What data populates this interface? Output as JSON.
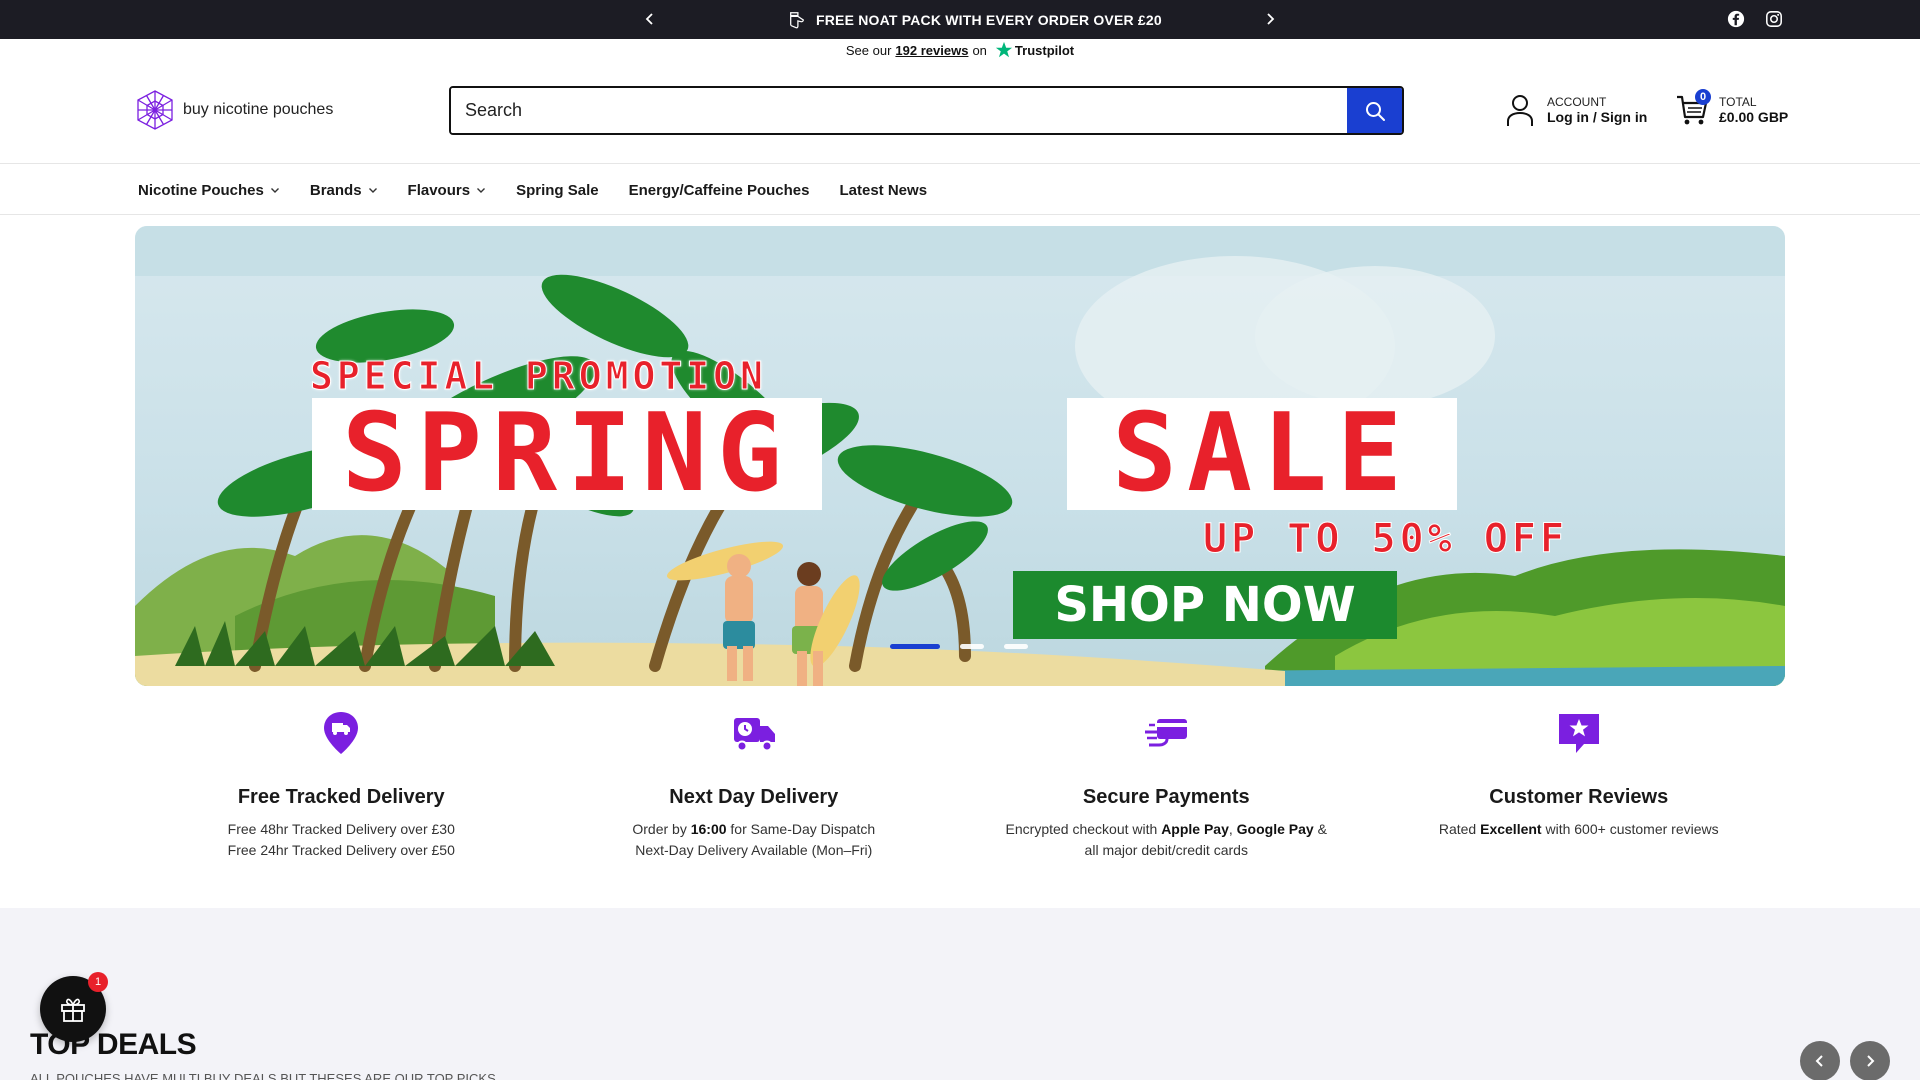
{
  "announcement": {
    "message": "FREE NOAT PACK WITH EVERY ORDER OVER £20",
    "message_icon": "thumbs-up-icon",
    "prev_icon": "chevron-left-icon",
    "next_icon": "chevron-right-icon",
    "social": [
      "facebook-icon",
      "instagram-icon"
    ]
  },
  "trustpilot": {
    "prefix": "See our",
    "count": "192 reviews",
    "on": "on",
    "brand": "Trustpilot"
  },
  "header": {
    "logo_text": "buy nicotine pouches",
    "search_placeholder": "Search",
    "account_label": "ACCOUNT",
    "account_action": "Log in / Sign in",
    "cart_count": "0",
    "cart_label": "TOTAL",
    "cart_total": "£0.00 GBP"
  },
  "nav": {
    "items": [
      {
        "label": "Nicotine Pouches",
        "dropdown": true
      },
      {
        "label": "Brands",
        "dropdown": true
      },
      {
        "label": "Flavours",
        "dropdown": true
      },
      {
        "label": "Spring Sale",
        "dropdown": false
      },
      {
        "label": "Energy/Caffeine Pouches",
        "dropdown": false
      },
      {
        "label": "Latest News",
        "dropdown": false
      }
    ]
  },
  "hero": {
    "promo": "SPECIAL PROMOTION",
    "word1": "SPRING",
    "word2": "SALE",
    "upto": "UP TO 50% OFF",
    "cta": "SHOP NOW",
    "slides": 3,
    "active_slide": 1
  },
  "features": [
    {
      "icon": "delivery-pin-icon",
      "title": "Free Tracked Delivery",
      "line1": "Free 48hr Tracked Delivery over £30",
      "line2": "Free 24hr Tracked Delivery over £50"
    },
    {
      "icon": "fast-truck-icon",
      "title": "Next Day Delivery",
      "line1_pre": "Order by ",
      "line1_bold": "16:00",
      "line1_post": " for Same-Day Dispatch",
      "line2": "Next-Day Delivery Available (Mon–Fri)"
    },
    {
      "icon": "card-payment-icon",
      "title": "Secure Payments",
      "line1_pre": "Encrypted checkout with ",
      "line1_bold1": "Apple Pay",
      "line1_mid": ", ",
      "line1_bold2": "Google Pay",
      "line1_post": " &",
      "line2": "all major debit/credit cards"
    },
    {
      "icon": "review-star-icon",
      "title": "Customer Reviews",
      "line1_pre": "Rated ",
      "line1_bold": "Excellent",
      "line1_post": " with 600+ customer reviews"
    }
  ],
  "deals": {
    "title": "TOP DEALS",
    "subtitle": "ALL POUCHES HAVE MULTI BUY DEALS BUT THESES ARE OUR TOP PICKS"
  },
  "gift_widget": {
    "badge": "1"
  },
  "colors": {
    "accent_blue": "#1a3fd1",
    "brand_purple": "#7b1fe0",
    "sale_red": "#e8212b",
    "cta_green": "#1c8a2e",
    "topbar": "#1c1c24"
  }
}
